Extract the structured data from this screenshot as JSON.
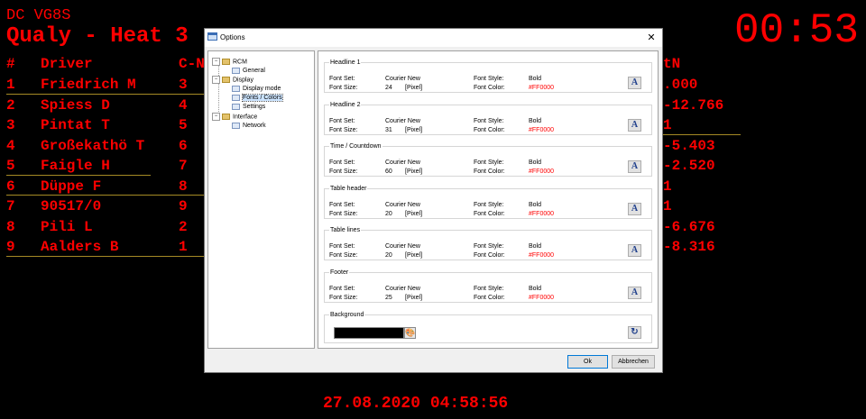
{
  "scoreboard": {
    "headline1": "DC VG8S",
    "headline2": "Qualy - Heat 3",
    "clock": "00:53",
    "footer": "27.08.2020 04:58:56",
    "columns": {
      "pos": "#",
      "driver": "Driver",
      "car": "C-N",
      "gap": "tN"
    },
    "rows": [
      {
        "pos": "1",
        "driver": "Friedrich M",
        "car": "3",
        "gap": ".000"
      },
      {
        "pos": "2",
        "driver": "Spiess D",
        "car": "4",
        "gap": "-12.766"
      },
      {
        "pos": "3",
        "driver": "Pintat T",
        "car": "5",
        "gap": "1"
      },
      {
        "pos": "4",
        "driver": "Großekathö T",
        "car": "6",
        "gap": "-5.403"
      },
      {
        "pos": "5",
        "driver": "Faigle H",
        "car": "7",
        "gap": "-2.520"
      },
      {
        "pos": "6",
        "driver": "Düppe F",
        "car": "8",
        "gap": "1"
      },
      {
        "pos": "7",
        "driver": "90517/0",
        "car": "9",
        "gap": "1"
      },
      {
        "pos": "8",
        "driver": "Pili L",
        "car": "2",
        "gap": "-6.676"
      },
      {
        "pos": "9",
        "driver": "Aalders B",
        "car": "1",
        "gap": "-8.316"
      }
    ]
  },
  "dialog": {
    "title": "Options",
    "close_glyph": "✕",
    "tree": {
      "rcm": "RCM",
      "general": "General",
      "display": "Display",
      "display_mode": "Display mode",
      "fonts_colors": "Fonts / Colors",
      "settings": "Settings",
      "interface": "Interface",
      "network": "Network"
    },
    "labels": {
      "font_set": "Font Set:",
      "font_size": "Font Size:",
      "font_style": "Font Style:",
      "font_color": "Font Color:",
      "unit": "[Pixel]",
      "font_button": "A"
    },
    "groups": [
      {
        "title": "Headline 1",
        "font": "Courier New",
        "size": "24",
        "style": "Bold",
        "color": "#FF0000"
      },
      {
        "title": "Headline 2",
        "font": "Courier New",
        "size": "31",
        "style": "Bold",
        "color": "#FF0000"
      },
      {
        "title": "Time / Countdown",
        "font": "Courier New",
        "size": "60",
        "style": "Bold",
        "color": "#FF0000"
      },
      {
        "title": "Table header",
        "font": "Courier New",
        "size": "20",
        "style": "Bold",
        "color": "#FF0000"
      },
      {
        "title": "Table lines",
        "font": "Courier New",
        "size": "20",
        "style": "Bold",
        "color": "#FF0000"
      },
      {
        "title": "Footer",
        "font": "Courier New",
        "size": "25",
        "style": "Bold",
        "color": "#FF0000"
      }
    ],
    "background": {
      "title": "Background",
      "color": "#000000",
      "reset_glyph": "↻"
    },
    "ok": "Ok",
    "cancel": "Abbrechen"
  }
}
